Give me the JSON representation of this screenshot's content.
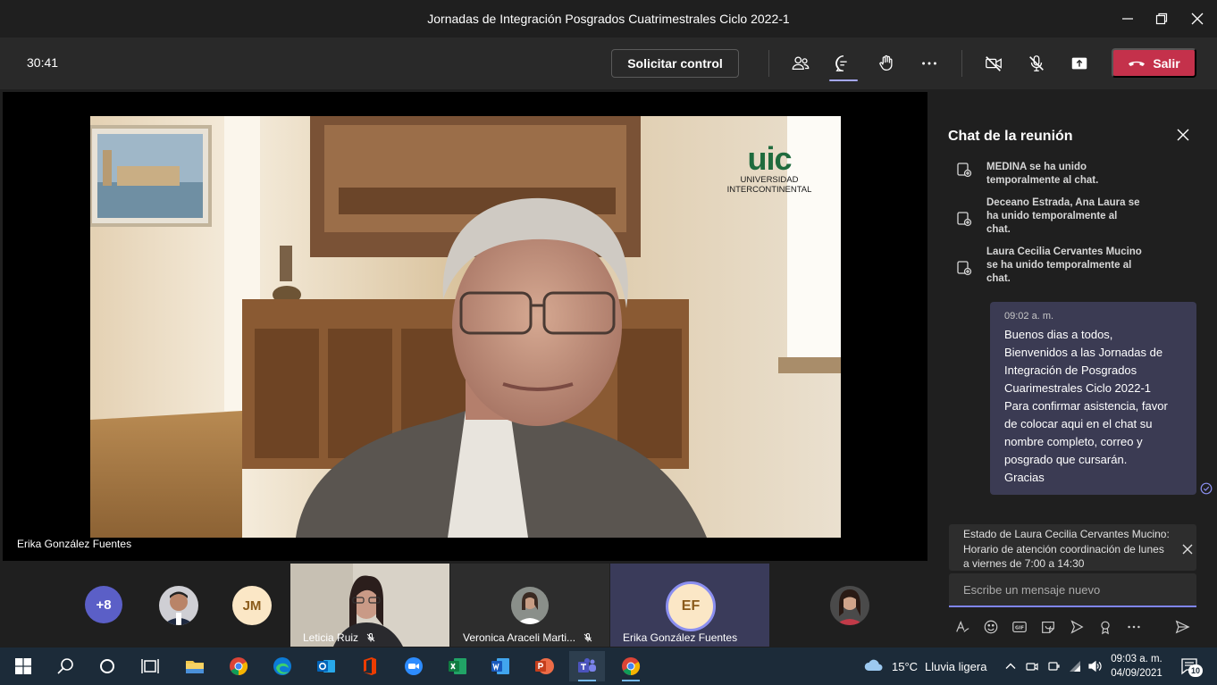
{
  "window": {
    "title": "Jornadas de Integración Posgrados Cuatrimestrales Ciclo 2022-1"
  },
  "meeting_bar": {
    "timer": "30:41",
    "request_control_label": "Solicitar control",
    "leave_label": "Salir",
    "tools": [
      "people-icon",
      "chat-icon",
      "raise-hand-icon",
      "more-icon",
      "camera-off-icon",
      "mic-off-icon",
      "share-icon"
    ]
  },
  "stage": {
    "speaker_name": "Erika González Fuentes",
    "logo_text": "uic",
    "logo_line1": "UNIVERSIDAD",
    "logo_line2": "INTERCONTINENTAL"
  },
  "strip": {
    "overflow_count": "+8",
    "jm_initials": "JM",
    "tiles": [
      {
        "name": "Leticia Ruiz"
      },
      {
        "name": "Veronica Araceli Marti..."
      },
      {
        "name": "Erika González Fuentes",
        "initials": "EF"
      }
    ]
  },
  "chat": {
    "title": "Chat de la reunión",
    "system_messages": [
      {
        "lines": [
          "MEDINA se ha unido",
          "temporalmente al chat."
        ]
      },
      {
        "lines": [
          "Deceano Estrada, Ana Laura se",
          "ha unido temporalmente al",
          "chat."
        ]
      },
      {
        "lines": [
          "Laura Cecilia Cervantes Mucino",
          "se ha unido temporalmente al",
          "chat."
        ]
      }
    ],
    "message": {
      "time": "09:02 a. m.",
      "lines": [
        "Buenos dias a todos,",
        "Bienvenidos a las Jornadas de",
        "Integración de Posgrados",
        "Cuarimestrales Ciclo 2022-1",
        "Para confirmar asistencia, favor",
        "de colocar aqui en el chat su",
        "nombre completo, correo y",
        "posgrado que cursarán.",
        "Gracias"
      ]
    },
    "status_lines": [
      "Estado de Laura Cecilia Cervantes Mucino:",
      "Horario de atención coordinación de lunes",
      "a viernes de 7:00 a 14:30"
    ],
    "compose_placeholder": "Escribe un mensaje nuevo"
  },
  "taskbar": {
    "weather_temp": "15°C",
    "weather_desc": "Lluvia ligera",
    "time": "09:03 a. m.",
    "date": "04/09/2021",
    "notification_count": "10"
  },
  "colors": {
    "leave_red": "#c4314b",
    "accent": "#7f85f5",
    "bubble": "#3b3b53",
    "taskbar": "#1c2b39"
  }
}
